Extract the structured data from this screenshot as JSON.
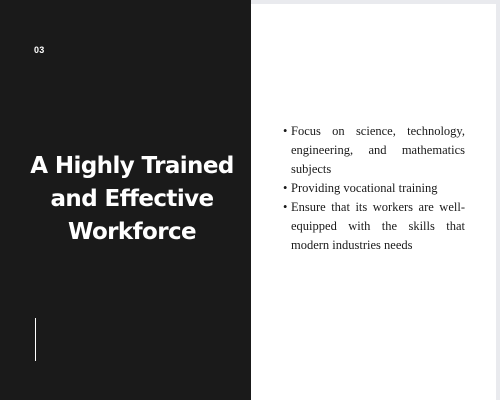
{
  "slide": {
    "number": "03",
    "title_lines": [
      "A Highly Trained",
      "and Effective",
      "Workforce"
    ],
    "bullets": [
      "Focus on science, technology, engineering, and mathematics subjects",
      "Providing vocational training",
      "Ensure that its workers are well-equipped with the skills that modern industries needs"
    ]
  },
  "colors": {
    "panel": "#1a1a1a",
    "text_light": "#ffffff",
    "text_dark": "#1a1a1a",
    "background": "#ffffff"
  }
}
